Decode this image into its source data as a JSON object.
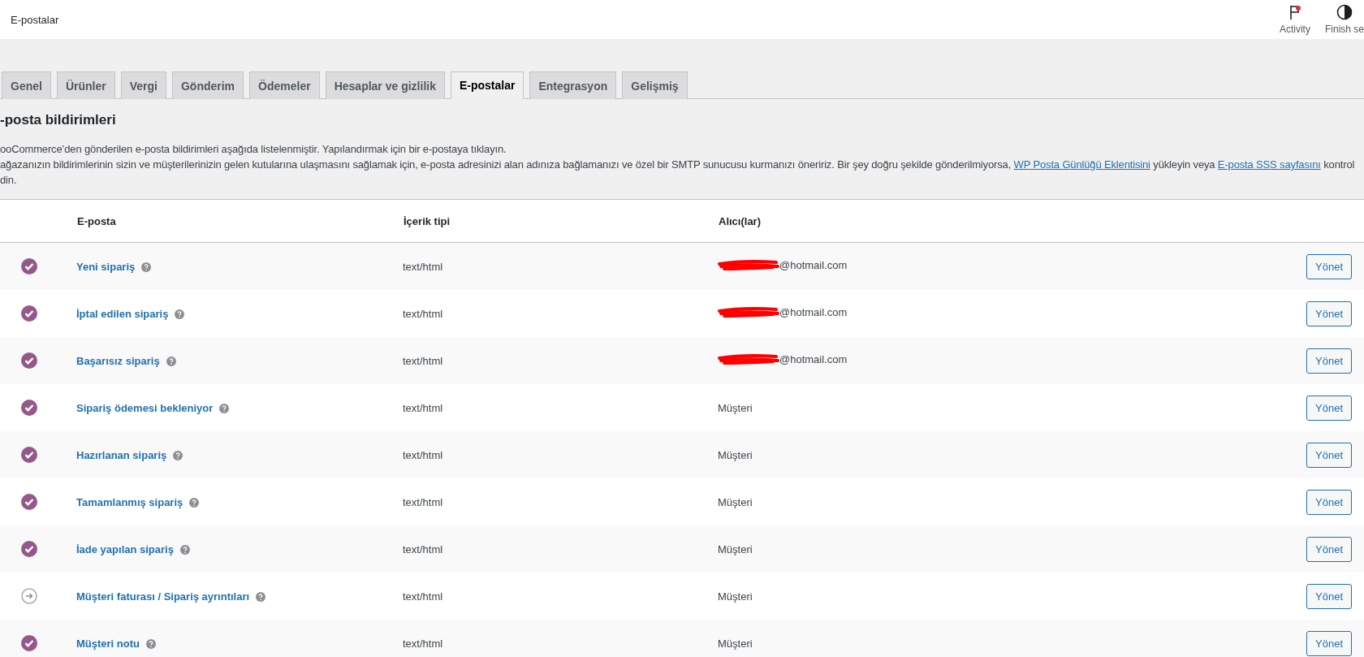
{
  "header": {
    "title": "E-postalar",
    "actions": [
      {
        "label": "Activity",
        "kind": "activity"
      },
      {
        "label": "Finish se",
        "kind": "finish"
      }
    ]
  },
  "tabs": [
    {
      "label": "Genel",
      "selected": false
    },
    {
      "label": "Ürünler",
      "selected": false
    },
    {
      "label": "Vergi",
      "selected": false
    },
    {
      "label": "Gönderim",
      "selected": false
    },
    {
      "label": "Ödemeler",
      "selected": false
    },
    {
      "label": "Hesaplar ve gizlilik",
      "selected": false
    },
    {
      "label": "E-postalar",
      "selected": true
    },
    {
      "label": "Entegrasyon",
      "selected": false
    },
    {
      "label": "Gelişmiş",
      "selected": false
    }
  ],
  "section": {
    "heading": "-posta bildirimleri",
    "intro": "ooCommerce’den gönderilen e-posta bildirimleri aşağıda listelenmiştir. Yapılandırmak için bir e-postaya tıklayın.",
    "note_start": "ağazanızın bildirimlerinin sizin ve müşterilerinizin gelen kutularına ulaşmasını sağlamak için, e-posta adresinizi alan adınıza bağlamanızı ve özel bir SMTP sunucusu kurmanızı öneririz. Bir şey doğru şekilde gönderilmiyorsa,",
    "link_1": "WP Posta Günlüğü Eklentisini",
    "note_middle": "yükleyin veya",
    "link_2": "E-posta SSS sayfasını",
    "note_end": "kontrol",
    "note_tail": "din."
  },
  "table": {
    "columns": [
      "E-posta",
      "İçerik tipi",
      "Alıcı(lar)"
    ],
    "rows": [
      {
        "kind": "enabled",
        "name": "Yeni sipariş",
        "content_type": "text/html",
        "recipient": "@hotmail.com",
        "redacted": true,
        "action": "Yönet"
      },
      {
        "kind": "enabled",
        "name": "İptal edilen sipariş",
        "content_type": "text/html",
        "recipient": "@hotmail.com",
        "redacted": true,
        "action": "Yönet"
      },
      {
        "kind": "enabled",
        "name": "Başarısız sipariş",
        "content_type": "text/html",
        "recipient": "@hotmail.com",
        "redacted": true,
        "action": "Yönet"
      },
      {
        "kind": "enabled",
        "name": "Sipariş ödemesi bekleniyor",
        "content_type": "text/html",
        "recipient": "Müşteri",
        "redacted": false,
        "action": "Yönet"
      },
      {
        "kind": "enabled",
        "name": "Hazırlanan sipariş",
        "content_type": "text/html",
        "recipient": "Müşteri",
        "redacted": false,
        "action": "Yönet"
      },
      {
        "kind": "enabled",
        "name": "Tamamlanmış sipariş",
        "content_type": "text/html",
        "recipient": "Müşteri",
        "redacted": false,
        "action": "Yönet"
      },
      {
        "kind": "enabled",
        "name": "İade yapılan sipariş",
        "content_type": "text/html",
        "recipient": "Müşteri",
        "redacted": false,
        "action": "Yönet"
      },
      {
        "kind": "manual",
        "name": "Müşteri faturası / Sipariş ayrıntıları",
        "content_type": "text/html",
        "recipient": "Müşteri",
        "redacted": false,
        "action": "Yönet"
      },
      {
        "kind": "enabled",
        "name": "Müşteri notu",
        "content_type": "text/html",
        "recipient": "Müşteri",
        "redacted": false,
        "action": "Yönet"
      }
    ]
  }
}
